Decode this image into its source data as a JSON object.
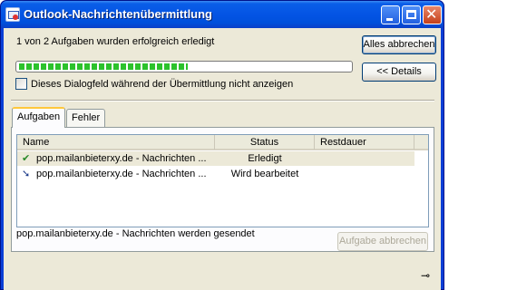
{
  "window": {
    "title": "Outlook-Nachrichtenübermittlung",
    "icon": "outlook-app-icon"
  },
  "progress": {
    "summary": "1 von 2 Aufgaben wurden erfolgreich erledigt",
    "percent": 51
  },
  "buttons": {
    "alles_abbrechen": "Alles abbrechen",
    "details": "<< Details",
    "aufgabe_abbrechen": "Aufgabe abbrechen"
  },
  "checkbox": {
    "label": "Dieses Dialogfeld während der Übermittlung nicht anzeigen",
    "checked": false
  },
  "tabs": [
    {
      "label": "Aufgaben",
      "active": true
    },
    {
      "label": "Fehler",
      "active": false
    }
  ],
  "table": {
    "columns": [
      "Name",
      "Status",
      "Restdauer"
    ],
    "rows": [
      {
        "icon": "checkmark-icon",
        "name": "pop.mailanbieterxy.de - Nachrichten ...",
        "status": "Erledigt",
        "rest": ""
      },
      {
        "icon": "in-progress-arrow-icon",
        "name": "pop.mailanbieterxy.de - Nachrichten ...",
        "status": "Wird bearbeitet",
        "rest": ""
      }
    ]
  },
  "status_line": "pop.mailanbieterxy.de - Nachrichten werden gesendet",
  "colors": {
    "titlebar": "#0454e4",
    "progress": "#2cc22c",
    "dialog_bg": "#ece9d8"
  }
}
